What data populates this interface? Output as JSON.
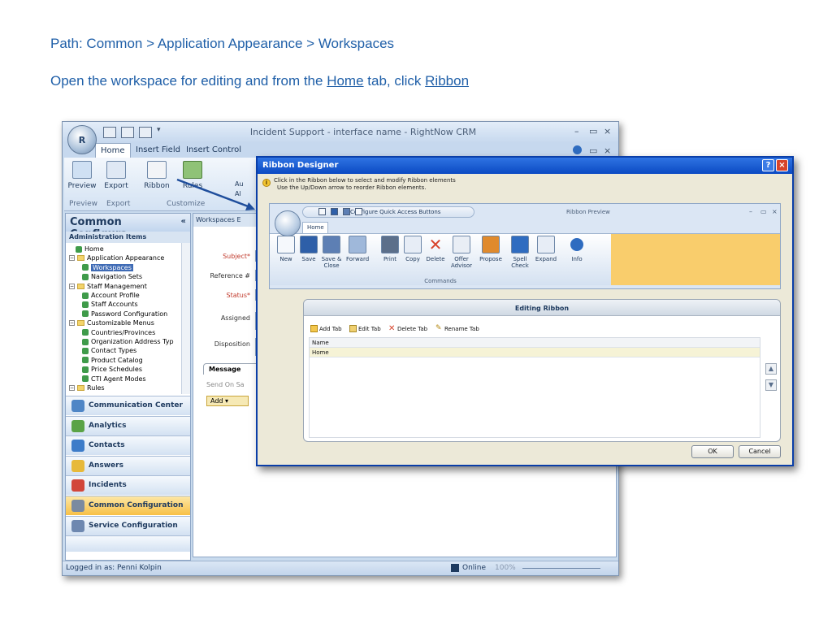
{
  "slide": {
    "path": "Path:  Common > Application Appearance > Workspaces",
    "instr_a": "Open the workspace for editing and from the ",
    "instr_home": "Home",
    "instr_b": " tab, click ",
    "instr_ribbon": "Ribbon"
  },
  "main_window": {
    "title": "Incident Support - interface name - RightNow CRM",
    "orb_text": "R",
    "tabs": [
      "Home",
      "Insert Field",
      "Insert Control"
    ],
    "ribbon_buttons": [
      "Preview",
      "Export",
      "Ribbon",
      "Rules"
    ],
    "ribbon_groups": [
      "Preview",
      "Export",
      "Customize"
    ],
    "nav_header": "Common Configura...",
    "nav_collapse": "«",
    "admin_items": "Administration Items",
    "tree": [
      {
        "label": "Home",
        "level": 1,
        "type": "item"
      },
      {
        "label": "Application Appearance",
        "level": 0,
        "type": "folder"
      },
      {
        "label": "Workspaces",
        "level": 2,
        "type": "item",
        "selected": true
      },
      {
        "label": "Navigation Sets",
        "level": 2,
        "type": "item"
      },
      {
        "label": "Staff Management",
        "level": 0,
        "type": "folder"
      },
      {
        "label": "Account Profile",
        "level": 2,
        "type": "item"
      },
      {
        "label": "Staff Accounts",
        "level": 2,
        "type": "item"
      },
      {
        "label": "Password Configuration",
        "level": 2,
        "type": "item"
      },
      {
        "label": "Customizable Menus",
        "level": 0,
        "type": "folder"
      },
      {
        "label": "Countries/Provinces",
        "level": 2,
        "type": "item"
      },
      {
        "label": "Organization Address Typ",
        "level": 2,
        "type": "item"
      },
      {
        "label": "Contact Types",
        "level": 2,
        "type": "item"
      },
      {
        "label": "Product Catalog",
        "level": 2,
        "type": "item"
      },
      {
        "label": "Price Schedules",
        "level": 2,
        "type": "item"
      },
      {
        "label": "CTI Agent Modes",
        "level": 2,
        "type": "item"
      },
      {
        "label": "Rules",
        "level": 0,
        "type": "folder"
      }
    ],
    "nav_buttons": [
      {
        "label": "Communication Center",
        "color": "#4f86c6"
      },
      {
        "label": "Analytics",
        "color": "#5aa346"
      },
      {
        "label": "Contacts",
        "color": "#3d7cc9"
      },
      {
        "label": "Answers",
        "color": "#e7b93a"
      },
      {
        "label": "Incidents",
        "color": "#d2463a"
      },
      {
        "label": "Common Configuration",
        "color": "#7a8aa0",
        "active": true
      },
      {
        "label": "Service Configuration",
        "color": "#6e88b0"
      }
    ],
    "workspace_tab": "Workspaces E",
    "ws_fields": [
      {
        "label": "Subject*",
        "req": true
      },
      {
        "label": "Reference #",
        "req": false
      },
      {
        "label": "Status*",
        "req": true
      },
      {
        "label": "Assigned",
        "req": false
      },
      {
        "label": "Disposition",
        "req": false
      }
    ],
    "ws_message_tab": "Message",
    "ws_send_on_save": "Send On Sa",
    "ws_add": "Add ▾",
    "ws_side_labels": [
      "Au",
      "Al"
    ],
    "status_left": "Logged in as: Penni Kolpin",
    "status_online": "Online",
    "status_zoom": "100%"
  },
  "dialog": {
    "title": "Ribbon Designer",
    "info_line1": "Click in the Ribbon below to select and modify Ribbon elements",
    "info_line2": "Use the Up/Down arrow to reorder Ribbon elements.",
    "qat_label": "Configure Quick Access Buttons",
    "preview_title": "Ribbon Preview",
    "preview_tab": "Home",
    "preview_buttons": [
      {
        "label": "New",
        "icon": "new-document-icon"
      },
      {
        "label": "Save",
        "icon": "save-icon"
      },
      {
        "label": "Save & Close",
        "icon": "save-close-icon"
      },
      {
        "label": "Forward",
        "icon": "forward-icon"
      },
      {
        "label": "Print",
        "icon": "print-icon"
      },
      {
        "label": "Copy",
        "icon": "copy-icon"
      },
      {
        "label": "Delete",
        "icon": "delete-icon"
      },
      {
        "label": "Offer Advisor",
        "icon": "offer-advisor-icon"
      },
      {
        "label": "Propose",
        "icon": "propose-icon"
      },
      {
        "label": "Spell Check",
        "icon": "spell-check-icon"
      },
      {
        "label": "Expand",
        "icon": "expand-icon"
      },
      {
        "label": "Info",
        "icon": "info-icon"
      }
    ],
    "preview_group": "Commands",
    "editing_title": "Editing Ribbon",
    "tools": [
      "Add Tab",
      "Edit Tab",
      "Delete Tab",
      "Rename Tab"
    ],
    "grid_header": "Name",
    "grid_rows": [
      "Home"
    ],
    "ok": "OK",
    "cancel": "Cancel"
  }
}
